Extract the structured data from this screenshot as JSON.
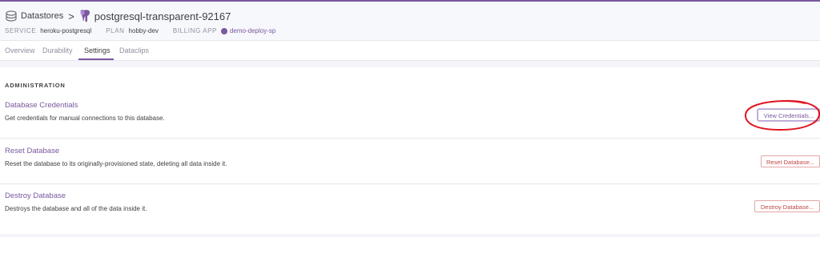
{
  "breadcrumb": {
    "root_label": "Datastores",
    "separator": ">",
    "database_name": "postgresql-transparent-92167"
  },
  "meta": {
    "service_key": "SERVICE",
    "service_value": "heroku-postgresql",
    "plan_key": "PLAN",
    "plan_value": "hobby-dev",
    "billing_key": "BILLING APP",
    "billing_value": "demo-deploy-sp"
  },
  "tabs": [
    {
      "label": "Overview",
      "active": false
    },
    {
      "label": "Durability",
      "active": false
    },
    {
      "label": "Settings",
      "active": true
    },
    {
      "label": "Dataclips",
      "active": false
    }
  ],
  "administration": {
    "heading": "ADMINISTRATION",
    "rows": [
      {
        "title": "Database Credentials",
        "description": "Get credentials for manual connections to this database.",
        "button": "View Credentials..."
      },
      {
        "title": "Reset Database",
        "description": "Reset the database to its originally-provisioned state, deleting all data inside it.",
        "button": "Reset Database..."
      },
      {
        "title": "Destroy Database",
        "description": "Destroys the database and all of the data inside it.",
        "button": "Destroy Database..."
      }
    ]
  },
  "colors": {
    "accent": "#79589f",
    "danger": "#c04848",
    "annotation": "#e0141e"
  },
  "icons": [
    "datastores-icon",
    "postgresql-elephant-icon",
    "app-dot-icon"
  ]
}
